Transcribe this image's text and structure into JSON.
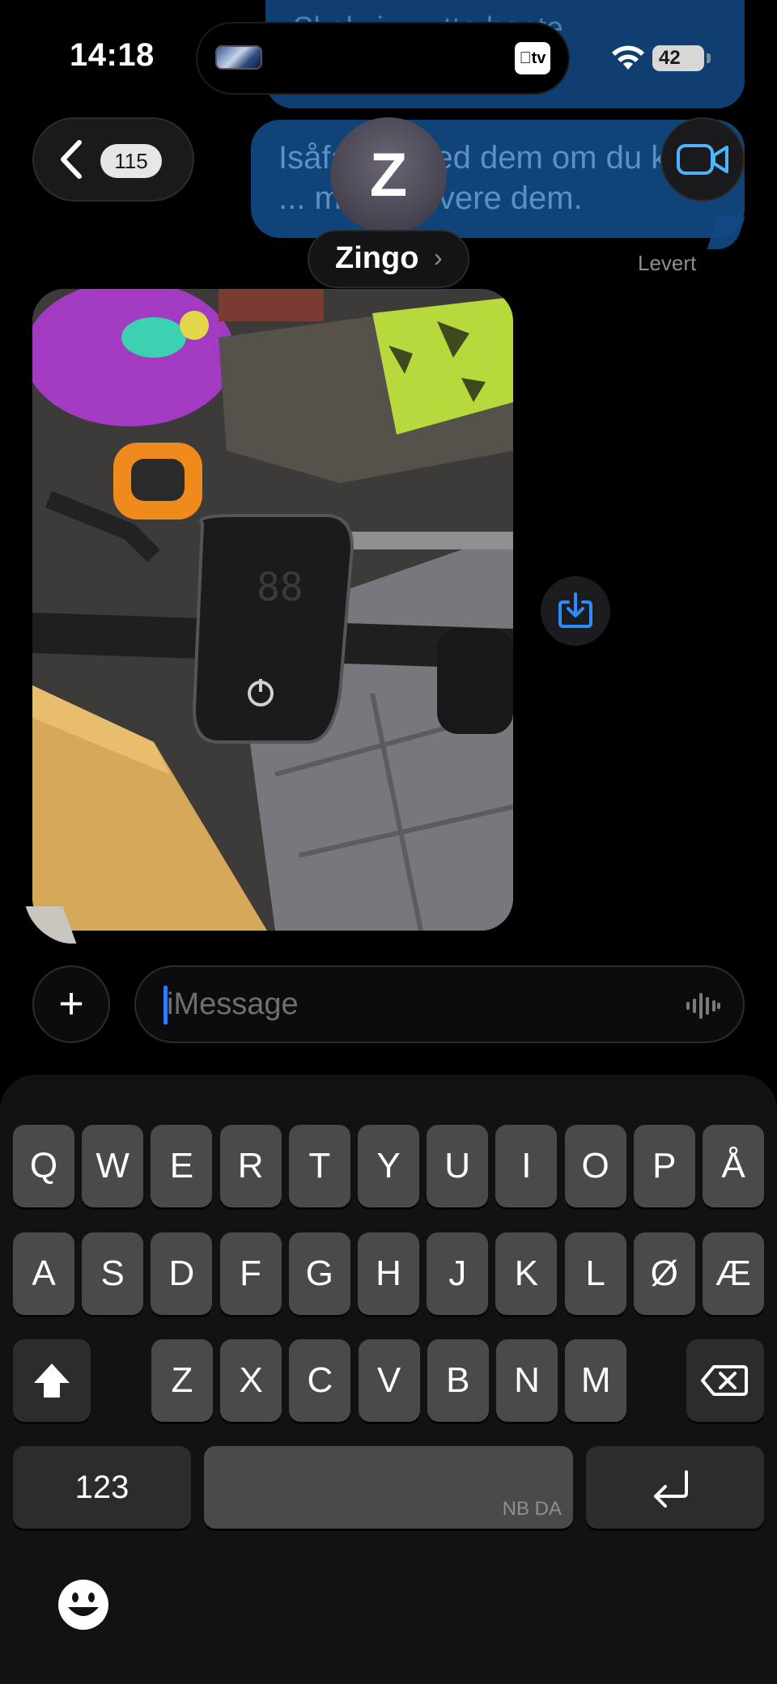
{
  "status_bar": {
    "time": "14:18",
    "tv_label": "tv",
    "battery": "42"
  },
  "background_messages": {
    "top_fragment": "Skal vi ... utta hente",
    "mid_fragment": "Isåfall ... med dem om du kan ... med å levere dem.",
    "delivery_status": "Levert"
  },
  "header": {
    "back_count": "115",
    "avatar_letter": "Z",
    "contact_name": "Zingo",
    "name_chevron": "›"
  },
  "composer": {
    "plus_label": "+",
    "placeholder": "iMessage"
  },
  "keyboard": {
    "row1": [
      "Q",
      "W",
      "E",
      "R",
      "T",
      "Y",
      "U",
      "I",
      "O",
      "P",
      "Å"
    ],
    "row2": [
      "A",
      "S",
      "D",
      "F",
      "G",
      "H",
      "J",
      "K",
      "L",
      "Ø",
      "Æ"
    ],
    "row3": [
      "Z",
      "X",
      "C",
      "V",
      "B",
      "N",
      "M"
    ],
    "numbers_label": "123",
    "space_languages": "NB DA",
    "shift_icon": "shift-arrow-up",
    "delete_icon": "backspace",
    "return_icon": "return-arrow"
  },
  "colors": {
    "bubble_blue": "#124a85",
    "accent_blue": "#2d7cf6",
    "key_gray": "#4a4a4c"
  }
}
